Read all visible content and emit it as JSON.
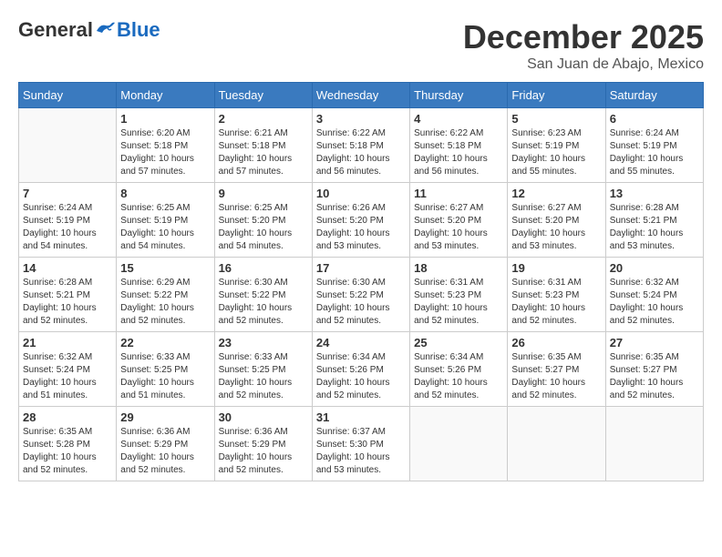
{
  "header": {
    "logo_general": "General",
    "logo_blue": "Blue",
    "month_title": "December 2025",
    "location": "San Juan de Abajo, Mexico"
  },
  "days_of_week": [
    "Sunday",
    "Monday",
    "Tuesday",
    "Wednesday",
    "Thursday",
    "Friday",
    "Saturday"
  ],
  "weeks": [
    [
      {
        "day": "",
        "info": ""
      },
      {
        "day": "1",
        "info": "Sunrise: 6:20 AM\nSunset: 5:18 PM\nDaylight: 10 hours\nand 57 minutes."
      },
      {
        "day": "2",
        "info": "Sunrise: 6:21 AM\nSunset: 5:18 PM\nDaylight: 10 hours\nand 57 minutes."
      },
      {
        "day": "3",
        "info": "Sunrise: 6:22 AM\nSunset: 5:18 PM\nDaylight: 10 hours\nand 56 minutes."
      },
      {
        "day": "4",
        "info": "Sunrise: 6:22 AM\nSunset: 5:18 PM\nDaylight: 10 hours\nand 56 minutes."
      },
      {
        "day": "5",
        "info": "Sunrise: 6:23 AM\nSunset: 5:19 PM\nDaylight: 10 hours\nand 55 minutes."
      },
      {
        "day": "6",
        "info": "Sunrise: 6:24 AM\nSunset: 5:19 PM\nDaylight: 10 hours\nand 55 minutes."
      }
    ],
    [
      {
        "day": "7",
        "info": "Sunrise: 6:24 AM\nSunset: 5:19 PM\nDaylight: 10 hours\nand 54 minutes."
      },
      {
        "day": "8",
        "info": "Sunrise: 6:25 AM\nSunset: 5:19 PM\nDaylight: 10 hours\nand 54 minutes."
      },
      {
        "day": "9",
        "info": "Sunrise: 6:25 AM\nSunset: 5:20 PM\nDaylight: 10 hours\nand 54 minutes."
      },
      {
        "day": "10",
        "info": "Sunrise: 6:26 AM\nSunset: 5:20 PM\nDaylight: 10 hours\nand 53 minutes."
      },
      {
        "day": "11",
        "info": "Sunrise: 6:27 AM\nSunset: 5:20 PM\nDaylight: 10 hours\nand 53 minutes."
      },
      {
        "day": "12",
        "info": "Sunrise: 6:27 AM\nSunset: 5:20 PM\nDaylight: 10 hours\nand 53 minutes."
      },
      {
        "day": "13",
        "info": "Sunrise: 6:28 AM\nSunset: 5:21 PM\nDaylight: 10 hours\nand 53 minutes."
      }
    ],
    [
      {
        "day": "14",
        "info": "Sunrise: 6:28 AM\nSunset: 5:21 PM\nDaylight: 10 hours\nand 52 minutes."
      },
      {
        "day": "15",
        "info": "Sunrise: 6:29 AM\nSunset: 5:22 PM\nDaylight: 10 hours\nand 52 minutes."
      },
      {
        "day": "16",
        "info": "Sunrise: 6:30 AM\nSunset: 5:22 PM\nDaylight: 10 hours\nand 52 minutes."
      },
      {
        "day": "17",
        "info": "Sunrise: 6:30 AM\nSunset: 5:22 PM\nDaylight: 10 hours\nand 52 minutes."
      },
      {
        "day": "18",
        "info": "Sunrise: 6:31 AM\nSunset: 5:23 PM\nDaylight: 10 hours\nand 52 minutes."
      },
      {
        "day": "19",
        "info": "Sunrise: 6:31 AM\nSunset: 5:23 PM\nDaylight: 10 hours\nand 52 minutes."
      },
      {
        "day": "20",
        "info": "Sunrise: 6:32 AM\nSunset: 5:24 PM\nDaylight: 10 hours\nand 52 minutes."
      }
    ],
    [
      {
        "day": "21",
        "info": "Sunrise: 6:32 AM\nSunset: 5:24 PM\nDaylight: 10 hours\nand 51 minutes."
      },
      {
        "day": "22",
        "info": "Sunrise: 6:33 AM\nSunset: 5:25 PM\nDaylight: 10 hours\nand 51 minutes."
      },
      {
        "day": "23",
        "info": "Sunrise: 6:33 AM\nSunset: 5:25 PM\nDaylight: 10 hours\nand 52 minutes."
      },
      {
        "day": "24",
        "info": "Sunrise: 6:34 AM\nSunset: 5:26 PM\nDaylight: 10 hours\nand 52 minutes."
      },
      {
        "day": "25",
        "info": "Sunrise: 6:34 AM\nSunset: 5:26 PM\nDaylight: 10 hours\nand 52 minutes."
      },
      {
        "day": "26",
        "info": "Sunrise: 6:35 AM\nSunset: 5:27 PM\nDaylight: 10 hours\nand 52 minutes."
      },
      {
        "day": "27",
        "info": "Sunrise: 6:35 AM\nSunset: 5:27 PM\nDaylight: 10 hours\nand 52 minutes."
      }
    ],
    [
      {
        "day": "28",
        "info": "Sunrise: 6:35 AM\nSunset: 5:28 PM\nDaylight: 10 hours\nand 52 minutes."
      },
      {
        "day": "29",
        "info": "Sunrise: 6:36 AM\nSunset: 5:29 PM\nDaylight: 10 hours\nand 52 minutes."
      },
      {
        "day": "30",
        "info": "Sunrise: 6:36 AM\nSunset: 5:29 PM\nDaylight: 10 hours\nand 52 minutes."
      },
      {
        "day": "31",
        "info": "Sunrise: 6:37 AM\nSunset: 5:30 PM\nDaylight: 10 hours\nand 53 minutes."
      },
      {
        "day": "",
        "info": ""
      },
      {
        "day": "",
        "info": ""
      },
      {
        "day": "",
        "info": ""
      }
    ]
  ]
}
